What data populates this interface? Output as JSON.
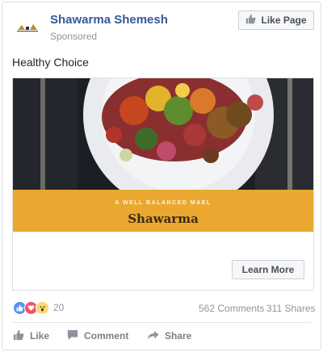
{
  "post": {
    "page_name": "Shawarma Shemesh",
    "sponsored_label": "Sponsored",
    "like_page_label": "Like Page",
    "text": "Healthy Choice"
  },
  "ad": {
    "tagline": "A WELL BALANCED MAEL",
    "name": "Shawarma",
    "cta_label": "Learn More",
    "banner_color": "#eba830"
  },
  "stats": {
    "reaction_count": "20",
    "comments": "562 Comments",
    "shares": "311 Shares",
    "reactions": [
      "like-icon",
      "love-icon",
      "wow-icon"
    ]
  },
  "actions": {
    "like": "Like",
    "comment": "Comment",
    "share": "Share"
  }
}
